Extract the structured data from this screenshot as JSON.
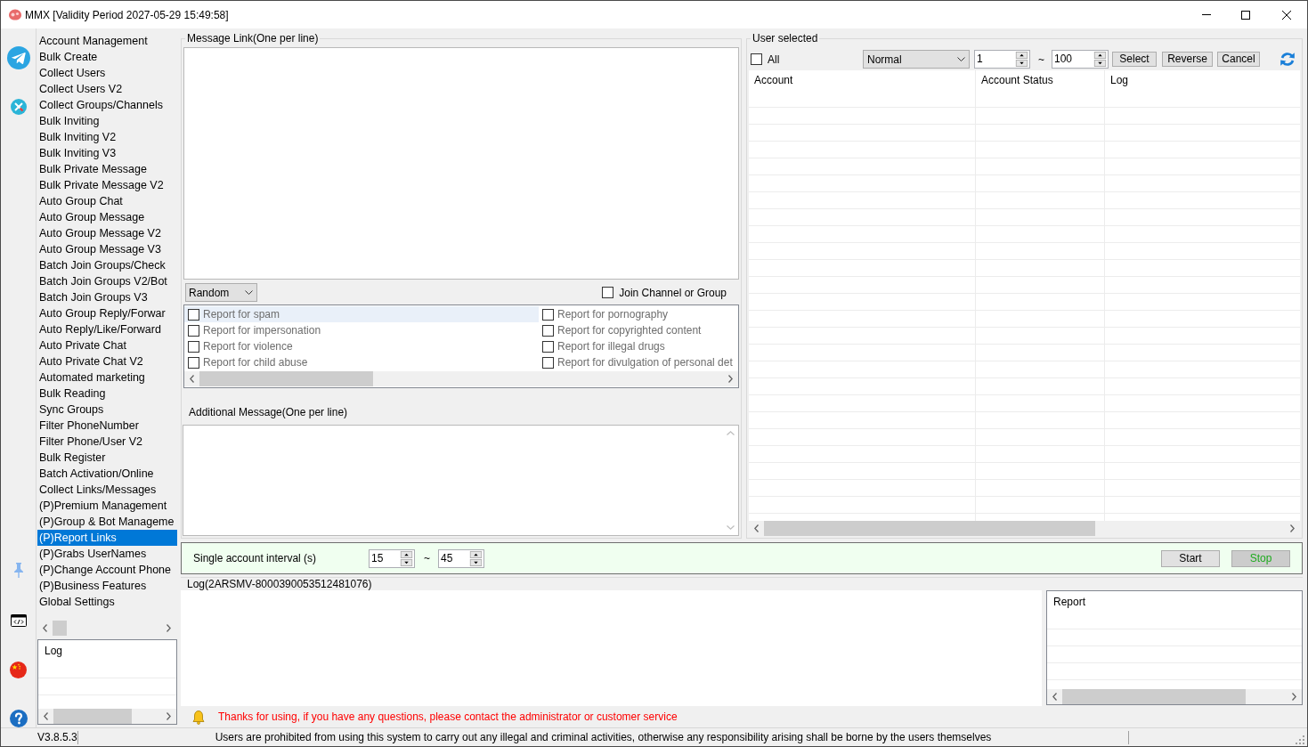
{
  "window": {
    "title": "MMX [Validity Period 2027-05-29 15:49:58]"
  },
  "sidebar": {
    "items": [
      {
        "label": "Account Management",
        "selected": false
      },
      {
        "label": "Bulk Create",
        "selected": false
      },
      {
        "label": "Collect Users",
        "selected": false
      },
      {
        "label": "Collect Users V2",
        "selected": false
      },
      {
        "label": "Collect Groups/Channels",
        "selected": false
      },
      {
        "label": "Bulk Inviting",
        "selected": false
      },
      {
        "label": "Bulk Inviting V2",
        "selected": false
      },
      {
        "label": "Bulk Inviting V3",
        "selected": false
      },
      {
        "label": "Bulk Private Message",
        "selected": false
      },
      {
        "label": "Bulk Private Message V2",
        "selected": false
      },
      {
        "label": "Auto Group Chat",
        "selected": false
      },
      {
        "label": "Auto Group Message",
        "selected": false
      },
      {
        "label": "Auto Group Message V2",
        "selected": false
      },
      {
        "label": "Auto Group Message V3",
        "selected": false
      },
      {
        "label": "Batch Join Groups/Check",
        "selected": false
      },
      {
        "label": "Batch Join Groups V2/Bot",
        "selected": false
      },
      {
        "label": "Batch Join Groups V3",
        "selected": false
      },
      {
        "label": "Auto Group Reply/Forwar",
        "selected": false
      },
      {
        "label": "Auto Reply/Like/Forward",
        "selected": false
      },
      {
        "label": "Auto Private Chat",
        "selected": false
      },
      {
        "label": "Auto Private Chat V2",
        "selected": false
      },
      {
        "label": "Automated marketing",
        "selected": false
      },
      {
        "label": "Bulk Reading",
        "selected": false
      },
      {
        "label": "Sync Groups",
        "selected": false
      },
      {
        "label": "Filter PhoneNumber",
        "selected": false
      },
      {
        "label": "Filter Phone/User V2",
        "selected": false
      },
      {
        "label": "Bulk Register",
        "selected": false
      },
      {
        "label": "Batch Activation/Online",
        "selected": false
      },
      {
        "label": "Collect Links/Messages",
        "selected": false
      },
      {
        "label": "(P)Premium Management",
        "selected": false
      },
      {
        "label": "(P)Group & Bot Manageme",
        "selected": false
      },
      {
        "label": "(P)Report Links",
        "selected": true
      },
      {
        "label": "(P)Grabs UserNames",
        "selected": false
      },
      {
        "label": "(P)Change Account Phone",
        "selected": false
      },
      {
        "label": "(P)Business Features",
        "selected": false
      },
      {
        "label": "Global Settings",
        "selected": false
      }
    ]
  },
  "sidebar_log": {
    "columns": [
      "Log"
    ]
  },
  "message_link": {
    "label": "Message Link(One per line)"
  },
  "order_select": {
    "value": "Random"
  },
  "join_channel": {
    "label": "Join Channel or Group",
    "checked": false
  },
  "report_reasons": [
    {
      "label": "Report for spam",
      "checked": false,
      "selected": true
    },
    {
      "label": "Report for impersonation",
      "checked": false,
      "selected": false
    },
    {
      "label": "Report for violence",
      "checked": false,
      "selected": false
    },
    {
      "label": "Report for child abuse",
      "checked": false,
      "selected": false
    },
    {
      "label": "Report for pornography",
      "checked": false,
      "selected": false
    },
    {
      "label": "Report for copyrighted content",
      "checked": false,
      "selected": false
    },
    {
      "label": "Report for illegal drugs",
      "checked": false,
      "selected": false
    },
    {
      "label": "Report for divulgation of personal det",
      "checked": false,
      "selected": false
    }
  ],
  "additional_message": {
    "label": "Additional Message(One per line)"
  },
  "user_panel": {
    "title": "User selected",
    "select_all": {
      "label": "All",
      "checked": false
    },
    "status_filter": {
      "value": "Normal"
    },
    "range": {
      "from": "1",
      "separator": "~",
      "to": "100"
    },
    "buttons": [
      "Select",
      "Reverse",
      "Cancel"
    ],
    "table": {
      "columns": [
        "Account",
        "Account Status",
        "Log"
      ]
    }
  },
  "interval": {
    "label": "Single account interval (s)",
    "from": "15",
    "separator": "~",
    "to": "45"
  },
  "actions": [
    {
      "label": "Start",
      "kind": "start"
    },
    {
      "label": "Stop",
      "kind": "stop"
    }
  ],
  "log_panel": {
    "title": "Log(2ARSMV-8000390053512481076)"
  },
  "report_list": {
    "columns": [
      "Report"
    ]
  },
  "notice": {
    "text": "Thanks for using, if you have any questions, please contact the administrator or customer service"
  },
  "status_bar": {
    "version": "V3.8.5.3",
    "message": "Users are prohibited from using this system to carry out any illegal and criminal activities, otherwise any responsibility arising shall be borne by the users themselves"
  }
}
